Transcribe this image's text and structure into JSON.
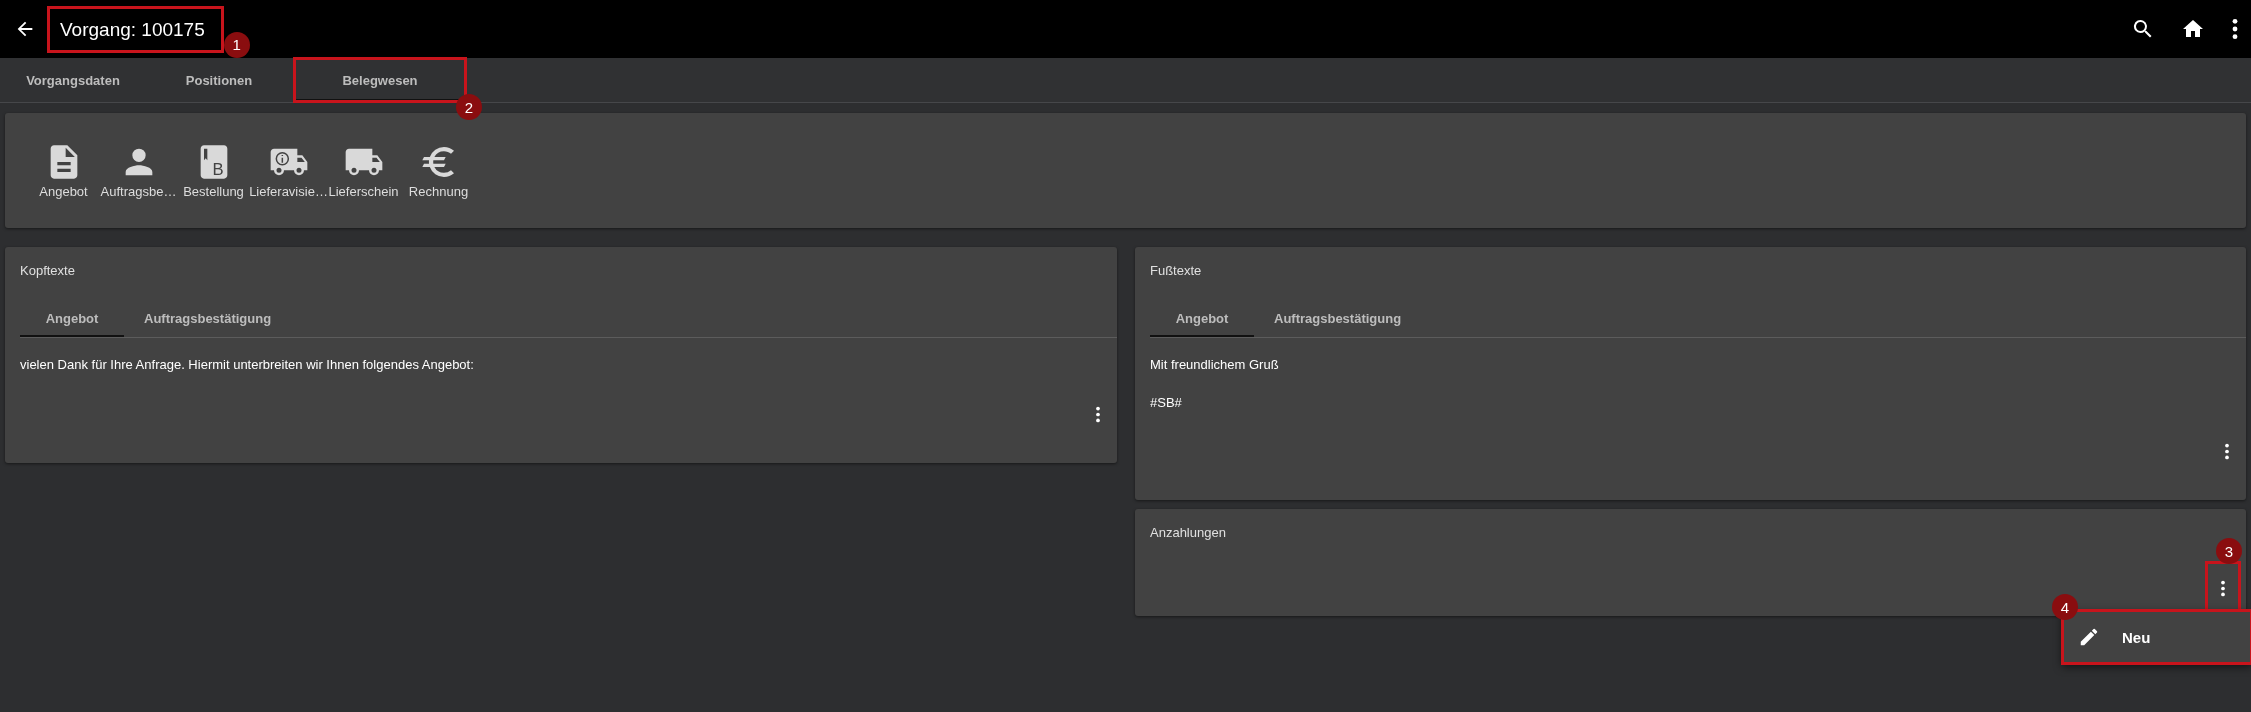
{
  "header": {
    "title": "Vorgang: 100175",
    "title_callout": "1"
  },
  "tabs": [
    {
      "label": "Vorgangsdaten",
      "selected": false
    },
    {
      "label": "Positionen",
      "selected": false
    },
    {
      "label": "Belegwesen",
      "selected": true,
      "callout": "2"
    }
  ],
  "documents": [
    {
      "kind": "offer",
      "label": "Angebot"
    },
    {
      "kind": "confirmation",
      "label": "Auftragsbe…"
    },
    {
      "kind": "order",
      "label": "Bestellung",
      "icon_letter": "B"
    },
    {
      "kind": "advice",
      "label": "Lieferavisie…"
    },
    {
      "kind": "delivery",
      "label": "Lieferschein"
    },
    {
      "kind": "invoice",
      "label": "Rechnung"
    }
  ],
  "header_texts": {
    "title": "Kopftexte",
    "tabs": [
      {
        "label": "Angebot",
        "selected": true
      },
      {
        "label": "Auftragsbestätigung",
        "selected": false
      }
    ],
    "lines": [
      "vielen Dank für Ihre Anfrage. Hiermit unterbreiten wir Ihnen folgendes Angebot:"
    ]
  },
  "footer_texts": {
    "title": "Fußtexte",
    "tabs": [
      {
        "label": "Angebot",
        "selected": true
      },
      {
        "label": "Auftragsbestätigung",
        "selected": false
      }
    ],
    "lines": [
      "Mit freundlichem Gruß",
      "#SB#"
    ]
  },
  "down_payments": {
    "title": "Anzahlungen",
    "menu_callout": "3",
    "menu": [
      {
        "label": "Neu",
        "callout": "4"
      }
    ]
  }
}
